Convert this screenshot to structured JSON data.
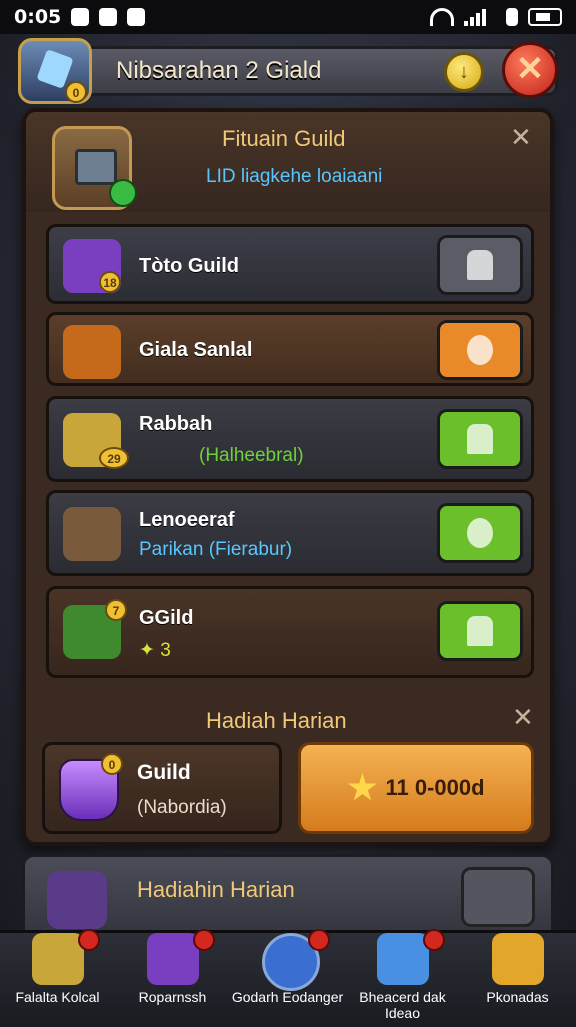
{
  "status_bar": {
    "time": "0:05"
  },
  "header": {
    "title": "Nibsarahan 2 Giald",
    "emblem_badge": "0",
    "info_button": "↓",
    "close_button": "✕"
  },
  "panel": {
    "title": "Fituain Guild",
    "subtitle": "LID liagkehe loaiaani",
    "close": "✕",
    "rows": [
      {
        "name": "Tòto Guild",
        "badge": "18",
        "sub": "",
        "sub_color": "",
        "button": "grey",
        "icon_color": "#7a3fc0"
      },
      {
        "name": "Giala Sanlal",
        "badge": "",
        "sub": "",
        "sub_color": "",
        "button": "orange",
        "icon_color": "#c46a1a"
      },
      {
        "name": "Rabbah",
        "badge": "29",
        "sub": "(Halheebral)",
        "sub_color": "#6fd13a",
        "button": "green",
        "icon_color": "#c9a63a"
      },
      {
        "name": "Lenoeeraf",
        "badge": "",
        "sub": "Parikan (Fierabur)",
        "sub_color": "#58c7ff",
        "button": "green",
        "icon_color": "#7a5a3c"
      },
      {
        "name": "GGild",
        "badge": "7",
        "sub": "✦ 3",
        "sub_color": "#d5e63a",
        "button": "green",
        "icon_color": "#3f8a2f"
      }
    ]
  },
  "daily": {
    "title": "Hadiah Harian",
    "close": "✕",
    "reward_name": "Guild",
    "reward_sub": "(Nabordia)",
    "reward_badge": "0",
    "claim_label": "11 0-000d"
  },
  "peek": {
    "title": "Hadiahin Harian"
  },
  "bottom_nav": [
    {
      "label": "Falalta Kolcal",
      "icon_color": "#c9a63a"
    },
    {
      "label": "Roparnssh",
      "icon_color": "#7a3fc0"
    },
    {
      "label": "Godarh Eodanger",
      "icon_color": "#3a6fd1"
    },
    {
      "label": "Bheacerd dak Ideao",
      "icon_color": "#4a90e2"
    },
    {
      "label": "Pkonadas",
      "icon_color": "#e2a72a"
    }
  ],
  "colors": {
    "accent_gold": "#f0c877",
    "button_green": "#6abf2a",
    "button_orange": "#e88a2a",
    "button_grey": "#5a5c66"
  }
}
